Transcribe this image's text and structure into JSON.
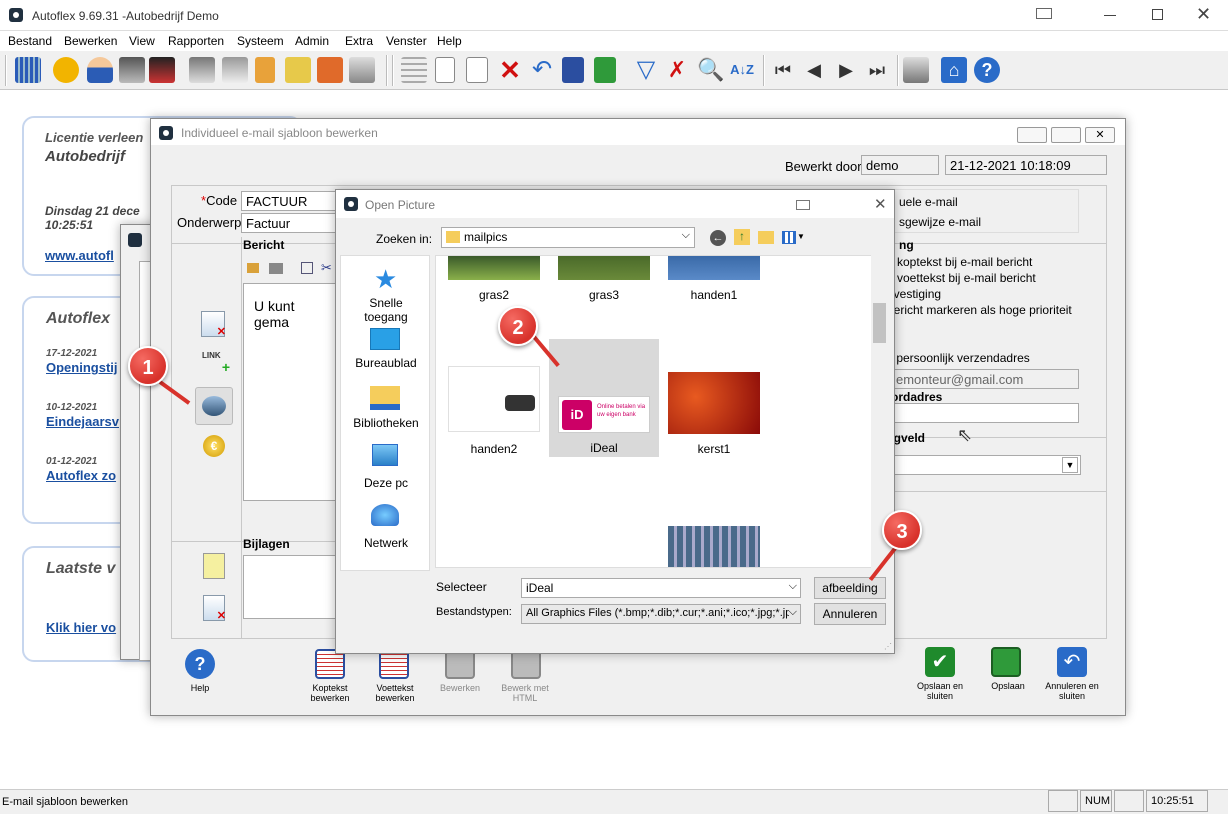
{
  "app": {
    "title": "Autoflex 9.69.31 -Autobedrijf Demo"
  },
  "menu": [
    "Bestand",
    "Bewerken",
    "View",
    "Rapporten",
    "Systeem",
    "Admin",
    "Extra",
    "Venster",
    "Help"
  ],
  "toolbar_icons": [
    "grid-icon",
    "users-icon",
    "person-icon",
    "cars-icon",
    "car-repair-icon",
    "truck-icon",
    "car-icon",
    "clipboard-icon",
    "money-icon",
    "parts-icon",
    "printer-icon",
    "table-icon",
    "new-doc-icon",
    "copy-doc-icon",
    "delete-icon",
    "undo-icon",
    "save-icon",
    "save-close-icon",
    "filter-icon",
    "clear-filter-icon",
    "search-icon",
    "sort-icon",
    "first-icon",
    "prev-icon",
    "next-icon",
    "last-icon",
    "print-icon",
    "home-icon",
    "help-icon"
  ],
  "bg_cards": {
    "card1": {
      "title": "Licentie verleen",
      "company": "Autobedrijf",
      "date": "Dinsdag 21 dece",
      "time": "10:25:51",
      "link": "www.autofl"
    },
    "card2": {
      "title": "Autoflex",
      "news": [
        {
          "date": "17-12-2021",
          "title": "Openingstij"
        },
        {
          "date": "10-12-2021",
          "title": "Eindejaarsv"
        },
        {
          "date": "01-12-2021",
          "title": "Autoflex zo"
        }
      ]
    },
    "card3": {
      "title": "Laatste v",
      "link": "Klik hier vo"
    }
  },
  "editor": {
    "title": "Individueel e-mail sjabloon bewerken",
    "edited_by_label": "Bewerkt door",
    "edited_by": "demo",
    "edited_at": "21-12-2021 10:18:09",
    "code_required": "*",
    "code_label": "Code",
    "code": "FACTUUR",
    "subject_label": "Onderwerp",
    "subject": "Factuur",
    "message_label": "Bericht",
    "message_text": "U kunt gema",
    "attachments_label": "Bijlagen",
    "right": {
      "radio1": "uele e-mail",
      "radio2": "sgewijze e-mail",
      "section": "ng",
      "cb1": "d koptekst bij e-mail bericht",
      "cb2": "d voettekst bij e-mail bericht",
      "cb3": "evestiging",
      "cb4": "bericht markeren als hoge prioriteit",
      "personal_label": "k persoonlijk verzendadres",
      "email": "emonteur@gmail.com",
      "reply_label": "ordadres",
      "merge_label": "egveld"
    },
    "bottom": [
      {
        "label": "Help",
        "icon": "help-icon"
      },
      {
        "label": "Koptekst bewerken",
        "icon": "header-edit-icon"
      },
      {
        "label": "Voettekst bewerken",
        "icon": "footer-edit-icon"
      },
      {
        "label": "Bewerken",
        "icon": "edit-icon"
      },
      {
        "label": "Bewerk met HTML",
        "icon": "html-edit-icon"
      },
      {
        "label": "Opslaan en sluiten",
        "icon": "save-close-icon"
      },
      {
        "label": "Opslaan",
        "icon": "save-icon"
      },
      {
        "label": "Annuleren en sluiten",
        "icon": "cancel-close-icon"
      }
    ]
  },
  "dialog": {
    "title": "Open Picture",
    "look_in_label": "Zoeken in:",
    "folder": "mailpics",
    "sidebar": [
      "Snelle toegang",
      "Bureaublad",
      "Bibliotheken",
      "Deze pc",
      "Netwerk"
    ],
    "files": [
      "gras2",
      "gras3",
      "handen1",
      "handen2",
      "iDeal",
      "kerst1"
    ],
    "ideal_text": "Online betalen via uw eigen bank",
    "select_label": "Selecteer",
    "select_value": "iDeal",
    "types_label": "Bestandstypen:",
    "types_value": "All Graphics Files (*.bmp;*.dib;*.cur;*.ani;*.ico;*.jpg;*.jpe",
    "ok": "afbeelding",
    "cancel": "Annuleren"
  },
  "callouts": [
    "1",
    "2",
    "3"
  ],
  "status": {
    "text": "E-mail sjabloon bewerken",
    "num": "NUM",
    "time": "10:25:51"
  },
  "colors": {
    "accent": "#1a4fa0",
    "badge": "#d8322b"
  }
}
